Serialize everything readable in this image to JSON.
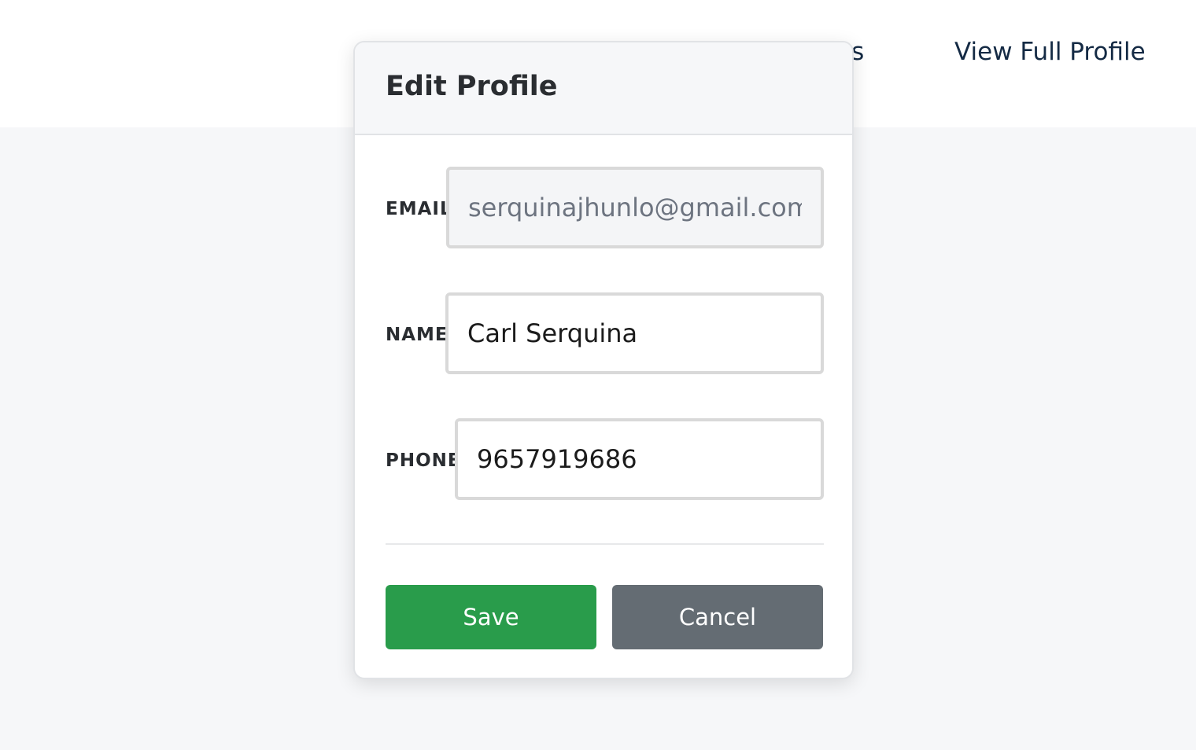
{
  "nav": {
    "partial_label": "ts",
    "full_profile_label": "View Full Profile"
  },
  "modal": {
    "title": "Edit Profile",
    "fields": {
      "email": {
        "label": "EMAIL",
        "value": "serquinajhunlo@gmail.com"
      },
      "name": {
        "label": "NAME",
        "value": "Carl Serquina"
      },
      "phone": {
        "label": "PHONE",
        "value": "9657919686"
      }
    },
    "buttons": {
      "save": "Save",
      "cancel": "Cancel"
    }
  },
  "colors": {
    "save": "#299c4b",
    "cancel": "#646c73",
    "background": "#f6f7f9",
    "nav_text": "#142a44"
  }
}
